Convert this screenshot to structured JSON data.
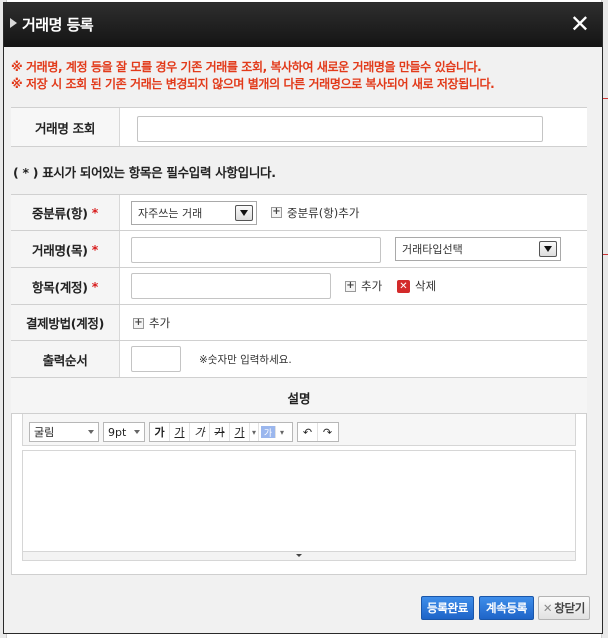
{
  "window": {
    "title": "거래명 등록"
  },
  "notice": {
    "line1": "※ 거래명, 계정 등을 잘 모를 경우 기존 거래를 조회, 복사하여 새로운 거래명을 만들수 있습니다.",
    "line2": "※ 저장 시 조회 된 기존 거래는 변경되지 않으며 별개의 다른 거래명으로 복사되어 새로 저장됩니다."
  },
  "lookup": {
    "label": "거래명 조회",
    "value": ""
  },
  "required_note": "( * ) 표시가 되어있는 항목은 필수입력 사항입니다.",
  "form": {
    "category": {
      "label": "중분류(항)",
      "required_mark": "*",
      "select_value": "자주쓰는 거래",
      "add_label": "중분류(항)추가"
    },
    "trade_name": {
      "label": "거래명(목)",
      "required_mark": "*",
      "value": "",
      "type_select_value": "거래타입선택"
    },
    "item": {
      "label": "항목(계정)",
      "required_mark": "*",
      "value": "",
      "add_label": "추가",
      "delete_label": "삭제"
    },
    "payment": {
      "label": "결제방법(계정)",
      "add_label": "추가"
    },
    "order": {
      "label": "출력순서",
      "value": "",
      "hint": "※숫자만 입력하세요."
    },
    "description": {
      "label": "설명"
    }
  },
  "editor": {
    "font": "굴림",
    "size": "9pt",
    "buttons": [
      "가",
      "가",
      "가",
      "가",
      "가",
      "가"
    ]
  },
  "actions": {
    "submit": "등록완료",
    "continue": "계속등록",
    "close": "창닫기"
  },
  "colors": {
    "notice": "#e23a1a",
    "primary_button": "#2a74d8",
    "required": "#d81b1b"
  }
}
